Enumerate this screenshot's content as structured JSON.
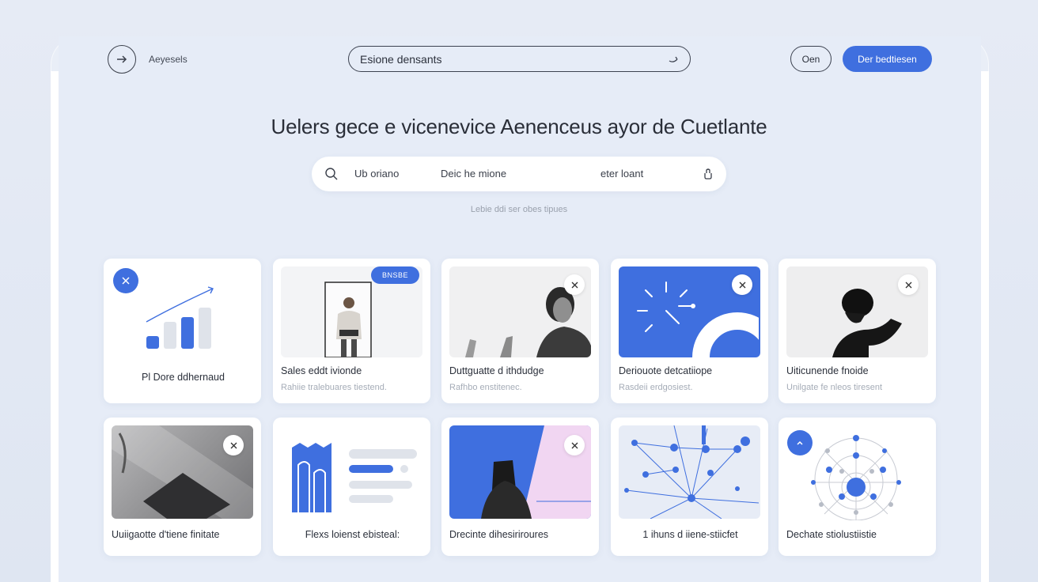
{
  "header": {
    "brand": "Aeyesels",
    "search_value": "Esione densants",
    "btn_outline": "Oen",
    "btn_primary": "Der bedtiesen"
  },
  "headline": "Uelers gece e vicenevice Aenenceus ayor de Cuetlante",
  "filters": {
    "f1": "Ub oriano",
    "f2": "Deic he mione",
    "f3": "eter loant"
  },
  "hint": "Lebie ddi ser obes tipues",
  "cards": [
    {
      "title": "Pl Dore ddhernaud",
      "subtitle": ""
    },
    {
      "title": "Sales eddt ivionde",
      "subtitle": "Rahiie tralebuares tiestend.",
      "tag": "BNSBE"
    },
    {
      "title": "Duttguatte d ithdudge",
      "subtitle": "Rafhbo enstitenec."
    },
    {
      "title": "Deriouote detcatiiope",
      "subtitle": "Rasdeii erdgosiest."
    },
    {
      "title": "Uiticunende fnoide",
      "subtitle": "Unilgate fe nleos tiresent"
    },
    {
      "title": "Uuiigaotte d'tiene finitate",
      "subtitle": ""
    },
    {
      "title": "Flexs loienst ebisteal:",
      "subtitle": ""
    },
    {
      "title": "Drecinte dihesiriroures",
      "subtitle": ""
    },
    {
      "title": "1 ihuns d iiene-stiicfet",
      "subtitle": ""
    },
    {
      "title": "Dechate stiolustiistie",
      "subtitle": ""
    }
  ],
  "colors": {
    "accent": "#3f6fdf",
    "background": "#e6ecf7",
    "card": "#ffffff"
  }
}
